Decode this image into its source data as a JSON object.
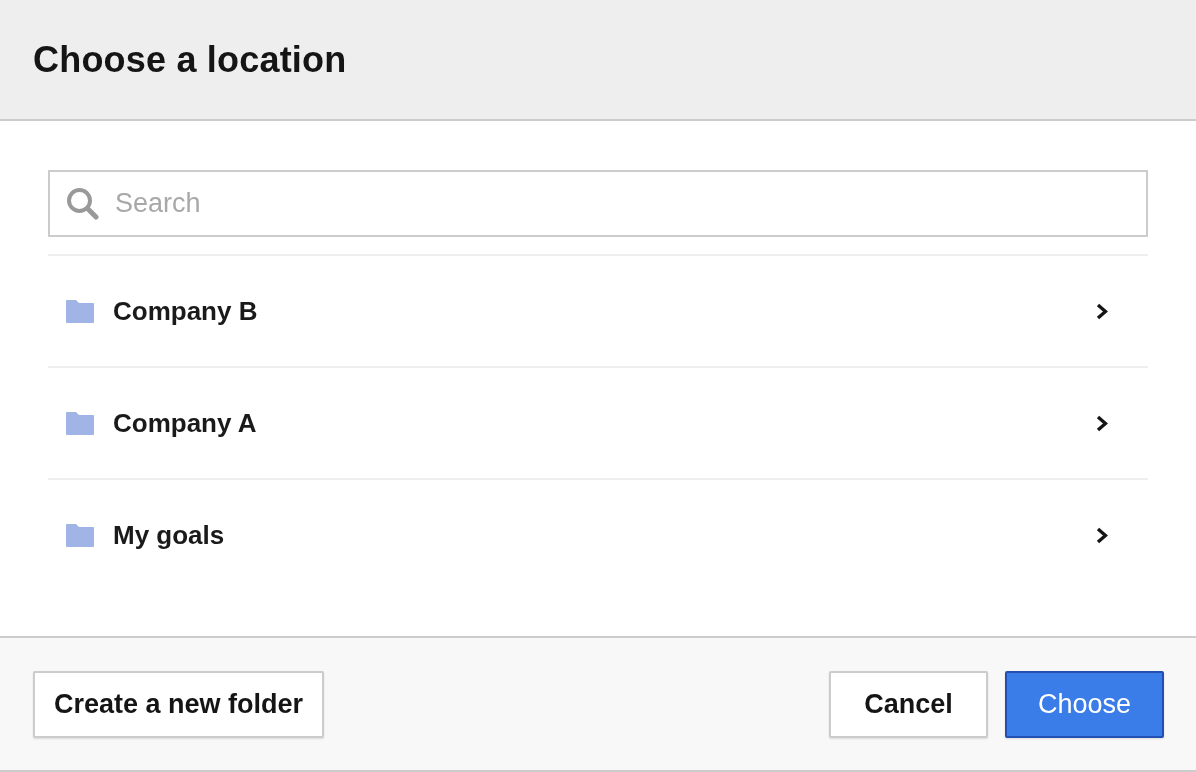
{
  "dialog": {
    "title": "Choose a location"
  },
  "search": {
    "placeholder": "Search"
  },
  "folders": [
    {
      "name": "Company B"
    },
    {
      "name": "Company A"
    },
    {
      "name": "My goals"
    }
  ],
  "footer": {
    "create_folder_button": {
      "label": "Create a new folder"
    },
    "buttons": [
      {
        "label": "Cancel",
        "kind": "secondary"
      },
      {
        "label": "Choose",
        "kind": "primary"
      }
    ]
  }
}
